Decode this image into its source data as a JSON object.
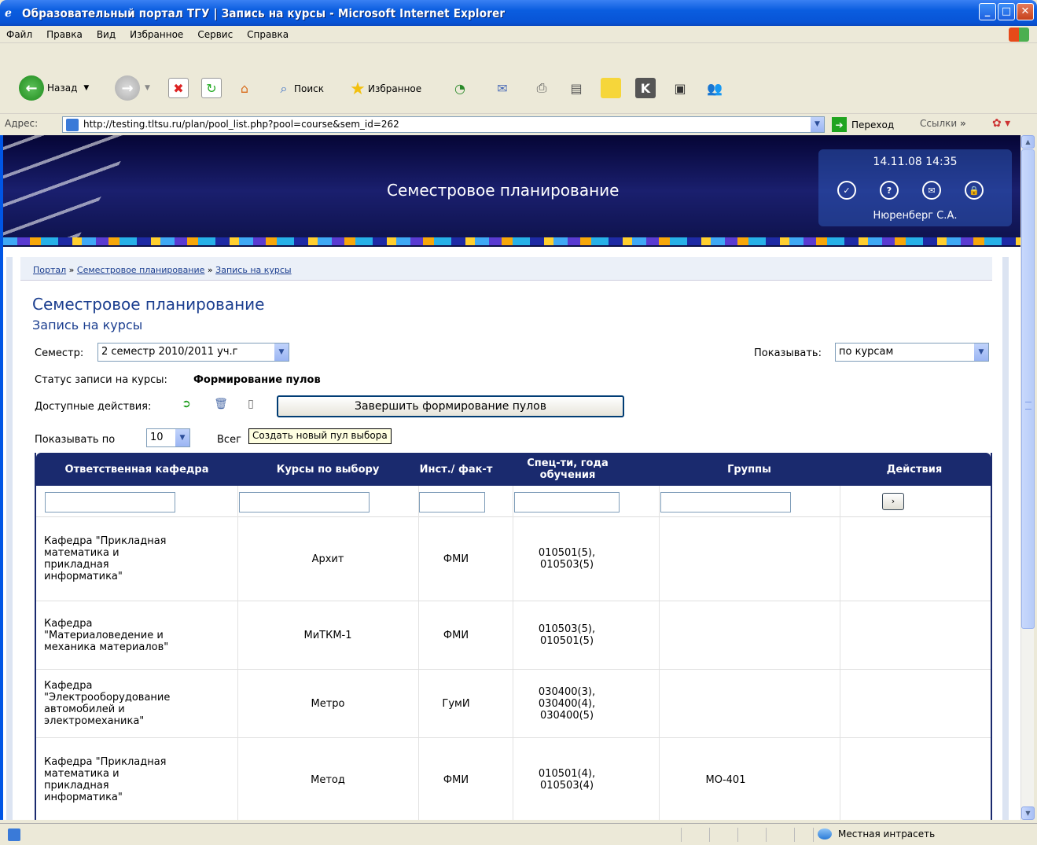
{
  "window": {
    "title": "Образовательный портал ТГУ | Запись на курсы - Microsoft Internet Explorer"
  },
  "menu": [
    "Файл",
    "Правка",
    "Вид",
    "Избранное",
    "Сервис",
    "Справка"
  ],
  "toolbar": {
    "back": "Назад",
    "search": "Поиск",
    "favorites": "Избранное"
  },
  "address": {
    "label": "Адрес:",
    "url": "http://testing.tltsu.ru/plan/pool_list.php?pool=course&sem_id=262",
    "go": "Переход",
    "links": "Ссылки"
  },
  "header": {
    "title": "Семестровое планирование",
    "datetime": "14.11.08 14:35",
    "user": "Нюренберг С.А."
  },
  "breadcrumb": {
    "portal": "Портал",
    "sep": "»",
    "plan": "Семестровое планирование",
    "current": "Запись на курсы"
  },
  "page": {
    "title": "Семестровое планирование",
    "subtitle": "Запись на курсы",
    "semester_label": "Семестр:",
    "semester_value": "2 семестр 2010/2011 уч.г",
    "show_label": "Показывать:",
    "show_value": "по курсам",
    "status_label": "Статус записи на курсы:",
    "status_value": "Формирование пулов",
    "actions_label": "Доступные действия:",
    "finish_button": "Завершить формирование пулов",
    "per_page_label": "Показывать по",
    "per_page_value": "10",
    "total_label": "Всег",
    "tooltip": "Создать новый пул выбора"
  },
  "table": {
    "headers": [
      "Ответственная кафедра",
      "Курсы по выбору",
      "Инст./ фак-т",
      "Спец-ти, года обучения",
      "Группы",
      "Действия"
    ],
    "go": "›",
    "rows": [
      {
        "dept": "Кафедра \"Прикладная математика и прикладная информатика\"",
        "course": "Архит",
        "inst": "ФМИ",
        "spec": "010501(5), 010503(5)",
        "groups": ""
      },
      {
        "dept": "Кафедра \"Материаловедение и механика материалов\"",
        "course": "МиТКМ-1",
        "inst": "ФМИ",
        "spec": "010503(5), 010501(5)",
        "groups": ""
      },
      {
        "dept": "Кафедра \"Электрооборудование автомобилей и электромеханика\"",
        "course": "Метро",
        "inst": "ГумИ",
        "spec": "030400(3), 030400(4), 030400(5)",
        "groups": ""
      },
      {
        "dept": "Кафедра \"Прикладная математика и прикладная информатика\"",
        "course": "Метод",
        "inst": "ФМИ",
        "spec": "010501(4), 010503(4)",
        "groups": "МО-401"
      }
    ]
  },
  "status": {
    "zone": "Местная интрасеть"
  },
  "colors": {
    "header_bg": "#1A2A6E",
    "link": "#1B3E8F",
    "tooltip_bg": "#FFFFE1"
  }
}
